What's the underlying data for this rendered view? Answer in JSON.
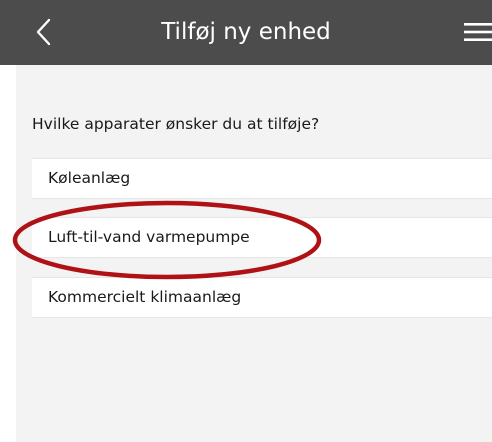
{
  "header": {
    "title": "Tilføj ny enhed",
    "back_icon": "chevron-left-icon",
    "menu_icon": "hamburger-menu-icon",
    "background_color": "#4c4c4c"
  },
  "main": {
    "question": "Hvilke apparater ønsker du at tilføje?",
    "options": [
      {
        "label": "Køleanlæg"
      },
      {
        "label": "Luft-til-vand varmepumpe"
      },
      {
        "label": "Kommercielt klimaanlæg"
      }
    ],
    "background_color": "#f3f3f3"
  },
  "annotation": {
    "shape": "ellipse",
    "color": "#b01116",
    "highlights_option": "Luft-til-vand varmepumpe"
  }
}
